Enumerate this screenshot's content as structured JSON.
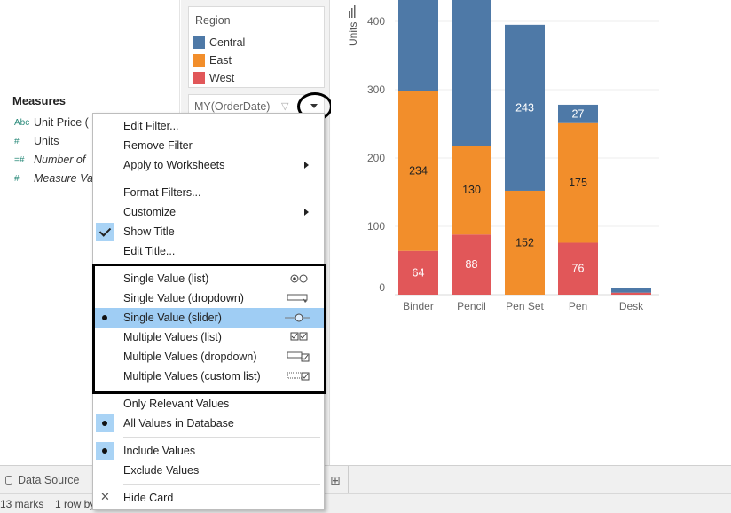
{
  "data_pane": {
    "measures_title": "Measures",
    "measures": [
      {
        "icon": "Abc",
        "label": "Unit Price (",
        "italic": false
      },
      {
        "icon": "#",
        "label": "Units",
        "italic": false
      },
      {
        "icon": "=#",
        "label": "Number of",
        "italic": true
      },
      {
        "icon": "#",
        "label": "Measure Va",
        "italic": true
      }
    ]
  },
  "legend": {
    "title": "Region",
    "items": [
      {
        "label": "Central",
        "color": "#4e79a7"
      },
      {
        "label": "East",
        "color": "#f28e2b"
      },
      {
        "label": "West",
        "color": "#e15759"
      }
    ]
  },
  "filter_card": {
    "label": "MY(OrderDate)"
  },
  "tabs": {
    "data_source": "Data Source"
  },
  "status": {
    "marks": "13 marks",
    "rows": "1 row by"
  },
  "menu": {
    "edit_filter": "Edit Filter...",
    "remove_filter": "Remove Filter",
    "apply_to_worksheets": "Apply to Worksheets",
    "format_filters": "Format Filters...",
    "customize": "Customize",
    "show_title": "Show Title",
    "edit_title": "Edit Title...",
    "single_value_list": "Single Value (list)",
    "single_value_dropdown": "Single Value (dropdown)",
    "single_value_slider": "Single Value (slider)",
    "multiple_values_list": "Multiple Values (list)",
    "multiple_values_dropdown": "Multiple Values (dropdown)",
    "multiple_values_custom": "Multiple Values (custom list)",
    "only_relevant": "Only Relevant Values",
    "all_values_db": "All Values in Database",
    "include_values": "Include Values",
    "exclude_values": "Exclude Values",
    "hide_card": "Hide Card"
  },
  "chart_data": {
    "type": "bar",
    "stacked": true,
    "ylabel": "Units",
    "y_ticks": [
      "0",
      "100",
      "200",
      "300",
      "400"
    ],
    "ylim": [
      0,
      430
    ],
    "categories": [
      "Binder",
      "Pencil",
      "Pen Set",
      "Pen",
      "Desk"
    ],
    "series": [
      {
        "name": "West",
        "color": "#e15759",
        "values": [
          64,
          88,
          0,
          76,
          3
        ],
        "labels": [
          "64",
          "88",
          "",
          "76",
          ""
        ]
      },
      {
        "name": "East",
        "color": "#f28e2b",
        "values": [
          234,
          130,
          152,
          175,
          0
        ],
        "labels": [
          "234",
          "130",
          "152",
          "175",
          ""
        ]
      },
      {
        "name": "Central",
        "color": "#4e79a7",
        "values": [
          150,
          250,
          243,
          27,
          7
        ],
        "labels": [
          "",
          "",
          "243",
          "27",
          ""
        ]
      }
    ]
  }
}
